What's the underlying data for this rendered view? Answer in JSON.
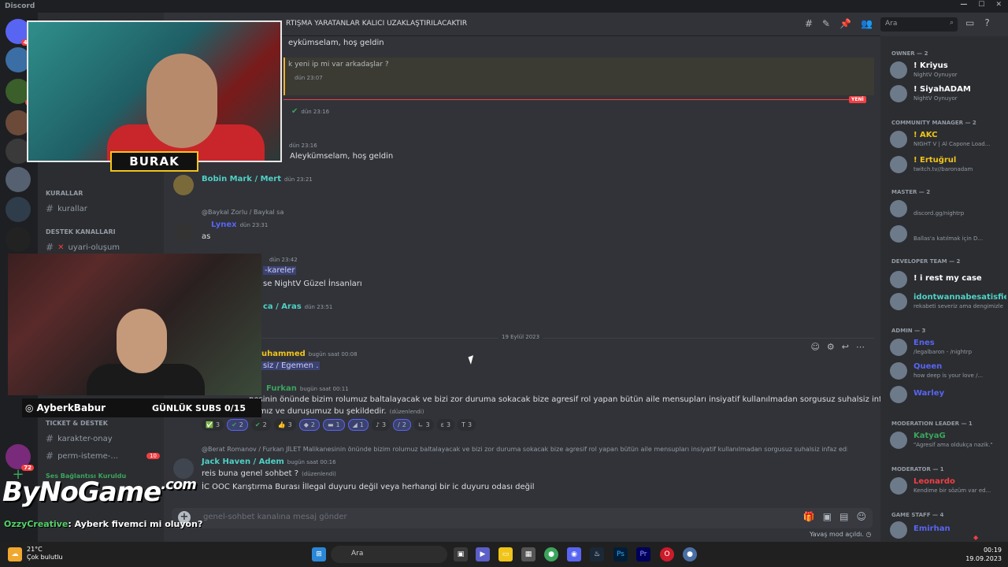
{
  "window": {
    "title": "Discord"
  },
  "channel_header": {
    "title": "RTIŞMA YARATANLAR KALICI UZAKLAŞTIRILACAKTIR"
  },
  "search": {
    "placeholder": "Ara"
  },
  "servers": {
    "badges": [
      "4K",
      "3",
      "72"
    ]
  },
  "channels": {
    "categories": [
      "KURALLAR",
      "DESTEK KANALLARI",
      "TICKET & DESTEK"
    ],
    "items": [
      {
        "label": "kurallar"
      },
      {
        "label": "uyari-oluşum"
      },
      {
        "label": "karakter-onay"
      },
      {
        "label": "perm-isteme-...",
        "badge": "10"
      }
    ],
    "voice_status": "Ses Bağlantısı Kuruldu"
  },
  "messages": {
    "m1_text": "eykümselam, hoş geldin",
    "m2_text": "k yeni ip mi var arkadaşlar ?",
    "m2_time": "dün 23:07",
    "new_tag": "YENİ",
    "m3_time": "dün 23:16",
    "m4_time": "dün 23:16",
    "m4_text": "Aleykümselam, hoş geldin",
    "m5_author": "Bobin Mark  / Mert",
    "m5_time": "dün 23:21",
    "m6_reply": "@Baykal Zorlu / Baykal  sa",
    "m6_author": "Lynex",
    "m6_time": "dün 23:31",
    "m6_text": "as",
    "m7_time": "dün 23:42",
    "m7_link": "-kareler",
    "m7_text": "se NightV Güzel İnsanları",
    "m8_author": "ca / Aras",
    "m8_time": "dün 23:51",
    "date_divider": "19 Eylül 2023",
    "m9_author": "uhammed",
    "m9_time": "bugün saat 00:08",
    "m9_text": "siz / Egemen .",
    "m10_author": "Furkan",
    "m10_time": "bugün saat 00:11",
    "m10_text1": "nesinin önünde bizim rolumuz baltalayacak ve bizi zor duruma sokacak bize agresif rol yapan bütün aile mensupları insiyatif kullanılmadan sorgusuz suhalsiz infaz",
    "m10_text2": "yırmız ve duruşumuz bu şekildedir.",
    "edited": "(düzenlendi)",
    "reactions": [
      "3",
      "2",
      "2",
      "3",
      "2",
      "1",
      "1",
      "3",
      "2",
      "3",
      "3",
      "3"
    ],
    "m11_reply": "@Berat Romanov / Furkan  JİLET Malikanesinin önünde bizim rolumuz baltalayacak ve bizi zor duruma sokacak bize agresif rol yapan bütün aile mensupları insiyatif kullanılmadan sorgusuz suhalsiz infaz edi",
    "m11_author": "Jack Haven / Adem",
    "m11_time": "bugün saat 00:16",
    "m11_text1": "reis buna genel sohbet ?",
    "m11_text2": "İC OOC Karıştırma Burası İllegal duyuru değil veya herhangi bir ic duyuru odası değil"
  },
  "composer": {
    "placeholder": "genel-sohbet kanalına mesaj gönder"
  },
  "slowmode": "Yavaş mod açıldı.",
  "members": {
    "groups": [
      {
        "name": "OWNER — 2"
      },
      {
        "name": "COMMUNITY MANAGER — 2"
      },
      {
        "name": "MASTER — 2"
      },
      {
        "name": "DEVELOPER TEAM — 2"
      },
      {
        "name": "ADMIN — 3"
      },
      {
        "name": "MODERATION LEADER — 1"
      },
      {
        "name": "MODERATOR — 1"
      },
      {
        "name": "GAME STAFF — 4"
      }
    ],
    "list": [
      {
        "name": "! Kriyus",
        "sub": "NightV Oynuyor",
        "color": "#ffffff"
      },
      {
        "name": "! SiyahADAM",
        "sub": "NightV Oynuyor",
        "color": "#ffffff"
      },
      {
        "name": "! AKC",
        "sub": "NIGHT V | Al Capone Load...",
        "color": "#f0c419"
      },
      {
        "name": "! Ertuğrul",
        "sub": "twitch.tv//baronadam",
        "color": "#f0c419"
      },
      {
        "name": "",
        "sub": "discord.gg/nightrp",
        "color": "#5865f2"
      },
      {
        "name": "",
        "sub": "Ballas'a katılmak için D...",
        "color": "#f0c419"
      },
      {
        "name": "! i rest my case",
        "sub": "",
        "color": "#ffffff"
      },
      {
        "name": "idontwannabesatisfied",
        "sub": "rekabeti severiz ama dengimizle",
        "color": "#4fd1c5"
      },
      {
        "name": "Enes",
        "sub": "/legalbaron - /nightrp",
        "color": "#5865f2"
      },
      {
        "name": "Queen",
        "sub": "how deep is your love /...",
        "color": "#5865f2"
      },
      {
        "name": "Warley",
        "sub": "",
        "color": "#5865f2"
      },
      {
        "name": "KatyaG",
        "sub": "\"Agresif ama oldukça nazik.\"",
        "color": "#3ba55d"
      },
      {
        "name": "Leonardo",
        "sub": "Kendime bir sözüm var ed...",
        "color": "#f23f43"
      },
      {
        "name": "Emirhan",
        "sub": "",
        "color": "#5865f2"
      }
    ]
  },
  "overlay": {
    "streamer_name": "BURAK",
    "handle": "AyberkBabur",
    "subs": "GÜNLÜK SUBS 0/15",
    "logo": "ByNoGame",
    "logo_suffix": ".com",
    "chat_user": "OzzyCreative",
    "chat_text": ": Ayberk fivemci mi oluyon?"
  },
  "taskbar": {
    "temperature": "21°C",
    "weather": "Çok bulutlu",
    "search": "Ara",
    "time": "00:19",
    "date": "19.09.2023"
  }
}
